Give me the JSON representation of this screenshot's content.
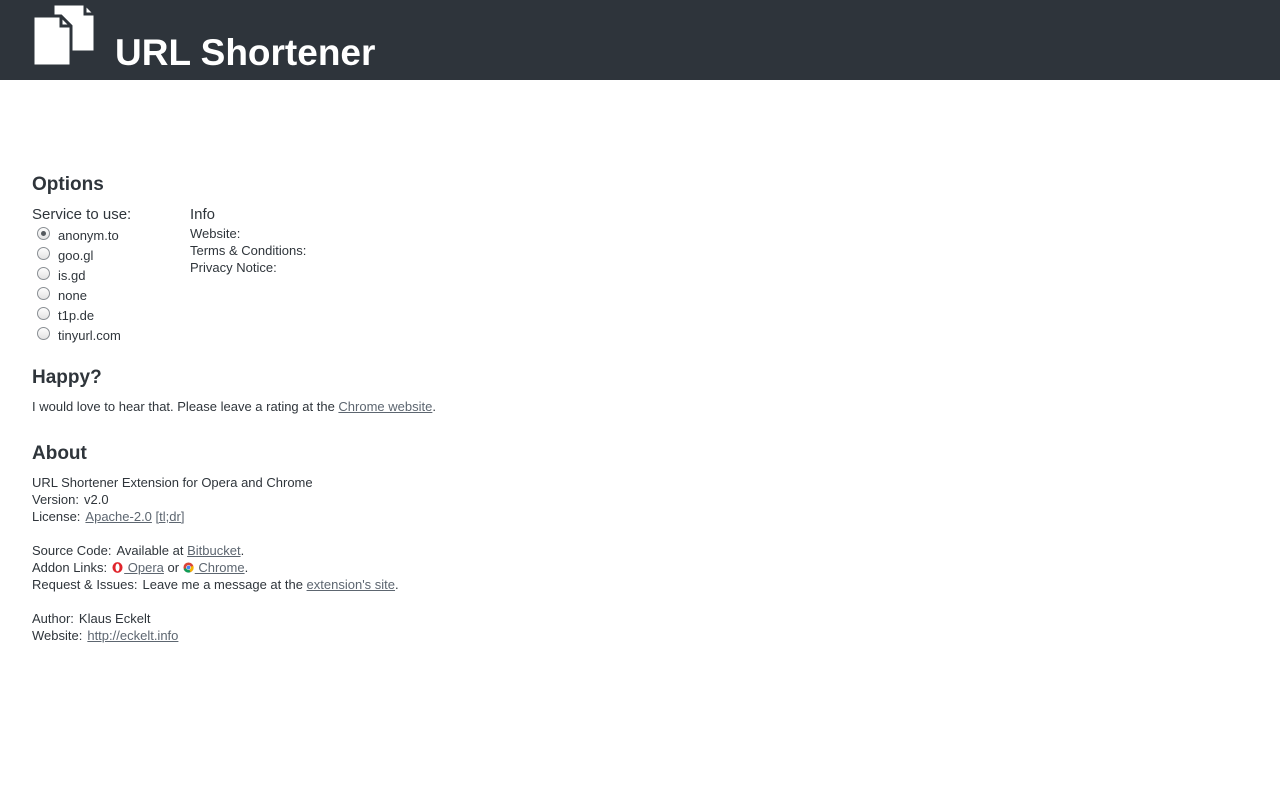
{
  "header": {
    "title": "URL Shortener",
    "logo_icon": "copy-documents-icon",
    "background": "#2e343b"
  },
  "options": {
    "heading": "Options",
    "service_label": "Service to use:",
    "services": [
      {
        "label": "anonym.to",
        "checked": true
      },
      {
        "label": "goo.gl",
        "checked": false
      },
      {
        "label": "is.gd",
        "checked": false
      },
      {
        "label": "none",
        "checked": false
      },
      {
        "label": "t1p.de",
        "checked": false
      },
      {
        "label": "tinyurl.com",
        "checked": false
      }
    ],
    "info": {
      "title": "Info",
      "website_label": "Website:",
      "terms_label": "Terms & Conditions:",
      "privacy_label": "Privacy Notice:"
    }
  },
  "happy": {
    "heading": "Happy?",
    "text_before": "I would love to hear that. Please leave a rating at the ",
    "link": "Chrome website",
    "text_after": "."
  },
  "about": {
    "heading": "About",
    "description": "URL Shortener Extension for Opera and Chrome",
    "version_label": "Version:",
    "version_value": "v2.0",
    "license_label": "License:",
    "license_link": "Apache-2.0",
    "license_tldr": "[tl;dr]",
    "source_label": "Source Code:",
    "source_text": "Available at ",
    "source_link": "Bitbucket",
    "source_after": ".",
    "addon_label": "Addon Links:",
    "addon_opera": " Opera",
    "addon_or": " or ",
    "addon_chrome": " Chrome",
    "addon_after": ".",
    "issues_label": "Request & Issues:",
    "issues_text": "Leave me a message at the ",
    "issues_link": "extension's site",
    "issues_after": ".",
    "author_label": "Author:",
    "author_value": "Klaus Eckelt",
    "website_label": "Website:",
    "website_link": "http://eckelt.info"
  }
}
